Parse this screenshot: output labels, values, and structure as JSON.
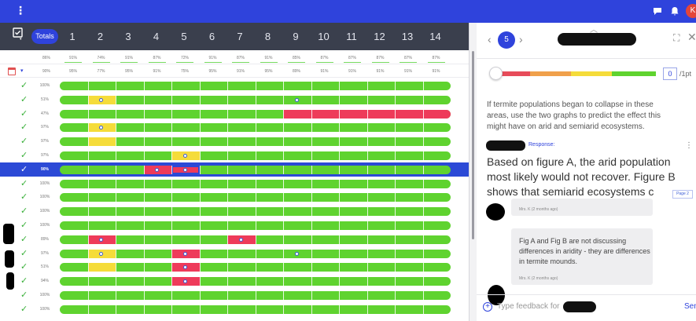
{
  "topbar": {
    "menu_icon": "⋮",
    "icons": [
      "chat-icon",
      "bell-icon"
    ],
    "avatar_initial": "K",
    "accent": "#2f43dc"
  },
  "grid": {
    "totals_label": "Totals",
    "questions": [
      "1",
      "2",
      "3",
      "4",
      "5",
      "6",
      "7",
      "8",
      "9",
      "10",
      "11",
      "12",
      "13",
      "14"
    ],
    "score_row_1": [
      "86%",
      "91%",
      "74%",
      "91%",
      "87%",
      "72%",
      "91%",
      "87%",
      "91%",
      "85%",
      "87%",
      "87%",
      "87%",
      "87%",
      "87%"
    ],
    "score_row_2": [
      "90%",
      "95%",
      "77%",
      "95%",
      "91%",
      "75%",
      "95%",
      "91%",
      "95%",
      "89%",
      "91%",
      "91%",
      "91%",
      "91%",
      "91%"
    ],
    "students": [
      {
        "pct": "100%",
        "segments": []
      },
      {
        "pct": "51%",
        "segments": [
          {
            "col": 2,
            "len": 1,
            "status": "partial",
            "dot": true
          }
        ],
        "dots": [
          {
            "col": 9
          }
        ]
      },
      {
        "pct": "47%",
        "segments": [
          {
            "col": 9,
            "len": 6,
            "status": "incorrect",
            "dot": false
          }
        ]
      },
      {
        "pct": "97%",
        "segments": [
          {
            "col": 2,
            "len": 1,
            "status": "partial",
            "dot": true
          }
        ]
      },
      {
        "pct": "97%",
        "segments": [
          {
            "col": 2,
            "len": 1,
            "status": "partial",
            "dot": false
          }
        ]
      },
      {
        "pct": "97%",
        "segments": [
          {
            "col": 5,
            "len": 1,
            "status": "partial",
            "dot": true
          }
        ]
      },
      {
        "pct": "90%",
        "selected": true,
        "segments": [
          {
            "col": 4,
            "len": 1,
            "status": "incorrect",
            "dot": true
          },
          {
            "col": 5,
            "len": 1,
            "status": "incorrect-selected",
            "dot": true
          }
        ]
      },
      {
        "pct": "100%",
        "segments": []
      },
      {
        "pct": "100%",
        "segments": []
      },
      {
        "pct": "100%",
        "segments": []
      },
      {
        "pct": "100%",
        "segments": []
      },
      {
        "pct": "89%",
        "segments": [
          {
            "col": 2,
            "len": 1,
            "status": "incorrect",
            "dot": true
          },
          {
            "col": 7,
            "len": 1,
            "status": "incorrect",
            "dot": true
          }
        ]
      },
      {
        "pct": "97%",
        "segments": [
          {
            "col": 2,
            "len": 1,
            "status": "partial",
            "dot": true
          },
          {
            "col": 5,
            "len": 1,
            "status": "incorrect",
            "dot": true
          }
        ],
        "dots": [
          {
            "col": 9
          }
        ]
      },
      {
        "pct": "51%",
        "segments": [
          {
            "col": 2,
            "len": 1,
            "status": "partial",
            "dot": false
          },
          {
            "col": 5,
            "len": 1,
            "status": "incorrect",
            "dot": true
          }
        ]
      },
      {
        "pct": "94%",
        "segments": [
          {
            "col": 5,
            "len": 1,
            "status": "incorrect",
            "dot": true
          }
        ]
      },
      {
        "pct": "100%",
        "segments": []
      },
      {
        "pct": "100%",
        "segments": []
      }
    ]
  },
  "colors": {
    "correct": "#5fd32f",
    "partial": "#f5dc3a",
    "incorrect": "#ee3b5a",
    "selected": "#2c4ad6"
  },
  "panel": {
    "question_number": "5",
    "score_value": "0",
    "score_max": "/1pt",
    "prompt": "If termite populations began to collapse in these areas, use the two graphs to predict the effect this might have on arid and semiarid ecosystems.",
    "response_label": "Response:",
    "response_text": "Based on figure A, the arid population most likely would not recover. Figure B shows that semiarid ecosystems c",
    "response_tag": "Page 2",
    "feedback": [
      {
        "text": "",
        "meta": "Mrs. K (2 months ago)"
      },
      {
        "text": "Fig A and Fig B are not discussing differences in aridity - they are differences in termite mounds.",
        "meta": "Mrs. K (2 months ago)"
      }
    ],
    "input_placeholder": "Type feedback for",
    "send_label": "Send"
  }
}
